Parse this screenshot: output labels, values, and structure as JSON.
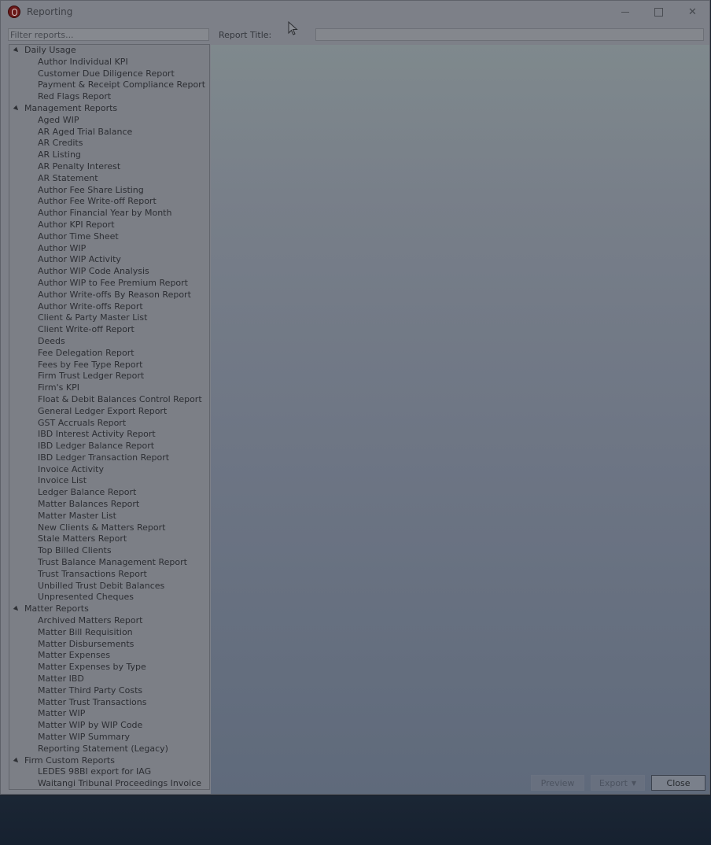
{
  "window": {
    "title": "Reporting",
    "controls": {
      "minimize": "minimize",
      "maximize": "maximize",
      "close": "✕"
    }
  },
  "filter": {
    "placeholder": "Filter reports..."
  },
  "report_title": {
    "label": "Report Title:",
    "value": ""
  },
  "tree": {
    "groups": [
      {
        "label": "Daily Usage",
        "items": [
          "Author Individual KPI",
          "Customer Due Diligence Report",
          "Payment & Receipt Compliance Report",
          "Red Flags Report"
        ]
      },
      {
        "label": "Management Reports",
        "items": [
          "Aged WIP",
          "AR Aged Trial Balance",
          "AR Credits",
          "AR Listing",
          "AR Penalty Interest",
          "AR Statement",
          "Author Fee Share Listing",
          "Author Fee Write-off Report",
          "Author Financial Year by Month",
          "Author KPI Report",
          "Author Time Sheet",
          "Author WIP",
          "Author WIP Activity",
          "Author WIP Code Analysis",
          "Author WIP to Fee Premium Report",
          "Author Write-offs By Reason Report",
          "Author Write-offs Report",
          "Client & Party Master List",
          "Client Write-off Report",
          "Deeds",
          "Fee Delegation Report",
          "Fees by Fee Type Report",
          "Firm Trust Ledger Report",
          "Firm's KPI",
          "Float & Debit Balances Control Report",
          "General Ledger Export Report",
          "GST Accruals Report",
          "IBD Interest Activity Report",
          "IBD Ledger Balance Report",
          "IBD Ledger Transaction Report",
          "Invoice Activity",
          "Invoice List",
          "Ledger Balance Report",
          "Matter Balances Report",
          "Matter Master List",
          "New Clients & Matters Report",
          "Stale Matters Report",
          "Top Billed Clients",
          "Trust Balance Management Report",
          "Trust Transactions Report",
          "Unbilled Trust Debit Balances",
          "Unpresented Cheques"
        ]
      },
      {
        "label": "Matter Reports",
        "items": [
          "Archived Matters Report",
          "Matter Bill Requisition",
          "Matter Disbursements",
          "Matter Expenses",
          "Matter Expenses by Type",
          "Matter IBD",
          "Matter Third Party Costs",
          "Matter Trust Transactions",
          "Matter WIP",
          "Matter WIP by WIP Code",
          "Matter WIP Summary",
          "Reporting Statement (Legacy)"
        ]
      },
      {
        "label": "Firm Custom Reports",
        "items": [
          "LEDES 98BI export for IAG",
          "Waitangi Tribunal Proceedings Invoice"
        ]
      }
    ]
  },
  "buttons": {
    "preview": "Preview",
    "export": "Export",
    "export_caret": "▼",
    "close": "Close"
  }
}
